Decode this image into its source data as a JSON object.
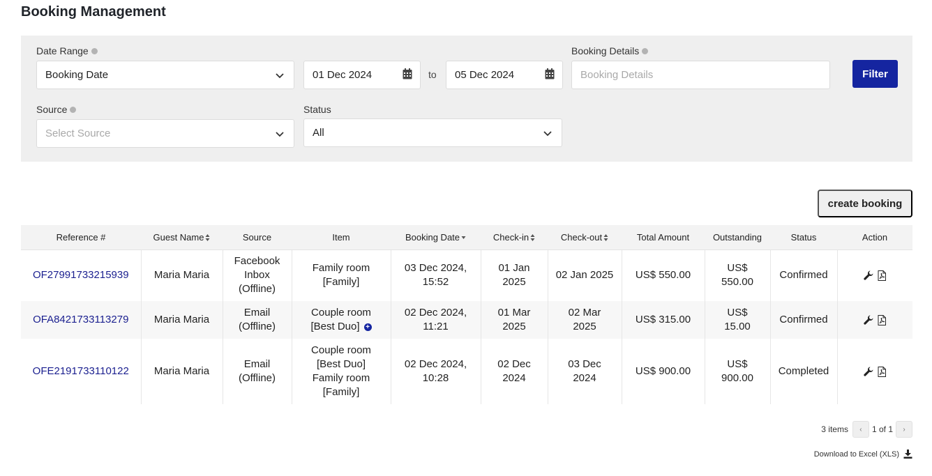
{
  "page": {
    "title": "Booking Management"
  },
  "filters": {
    "date_range_label": "Date Range",
    "date_range_value": "Booking Date",
    "date_from": "01 Dec 2024",
    "to_label": "to",
    "date_to": "05 Dec 2024",
    "booking_details_label": "Booking Details",
    "booking_details_placeholder": "Booking Details",
    "filter_button": "Filter",
    "source_label": "Source",
    "source_placeholder": "Select Source",
    "status_label": "Status",
    "status_value": "All"
  },
  "actions": {
    "create_booking": "create booking"
  },
  "table": {
    "columns": [
      "Reference #",
      "Guest Name",
      "Source",
      "Item",
      "Booking Date",
      "Check-in",
      "Check-out",
      "Total Amount",
      "Outstanding",
      "Status",
      "Action"
    ],
    "rows": [
      {
        "reference": "OF27991733215939",
        "guest": "Maria Maria",
        "source": [
          "Facebook",
          "Inbox",
          "(Offline)"
        ],
        "item": [
          "Family room",
          "[Family]"
        ],
        "booking_date": [
          "03 Dec 2024,",
          "15:52"
        ],
        "check_in": [
          "01 Jan",
          "2025"
        ],
        "check_out": [
          "02 Jan 2025"
        ],
        "total": "US$ 550.00",
        "outstanding": [
          "US$",
          "550.00"
        ],
        "status": "Confirmed"
      },
      {
        "reference": "OFA8421733113279",
        "guest": "Maria Maria",
        "source": [
          "Email",
          "(Offline)"
        ],
        "item": [
          "Couple room",
          "[Best Duo]"
        ],
        "booking_date": [
          "02 Dec 2024,",
          "11:21"
        ],
        "check_in": [
          "01 Mar",
          "2025"
        ],
        "check_out": [
          "02 Mar",
          "2025"
        ],
        "total": "US$ 315.00",
        "outstanding": [
          "US$",
          "15.00"
        ],
        "status": "Confirmed"
      },
      {
        "reference": "OFE2191733110122",
        "guest": "Maria Maria",
        "source": [
          "Email",
          "(Offline)"
        ],
        "item": [
          "Couple room",
          "[Best Duo]",
          "Family room",
          "[Family]"
        ],
        "booking_date": [
          "02 Dec 2024,",
          "10:28"
        ],
        "check_in": [
          "02 Dec",
          "2024"
        ],
        "check_out": [
          "03 Dec",
          "2024"
        ],
        "total": "US$ 900.00",
        "outstanding": [
          "US$",
          "900.00"
        ],
        "status": "Completed"
      }
    ]
  },
  "pagination": {
    "count": "3 items",
    "page": "1 of 1",
    "prev": "‹",
    "next": "›"
  },
  "download": {
    "label": "Download to Excel (XLS)"
  },
  "colors": {
    "primary": "#1525a0",
    "link": "#1a1f8f",
    "outstanding": "#ee8a2a",
    "panel": "#efefef"
  }
}
